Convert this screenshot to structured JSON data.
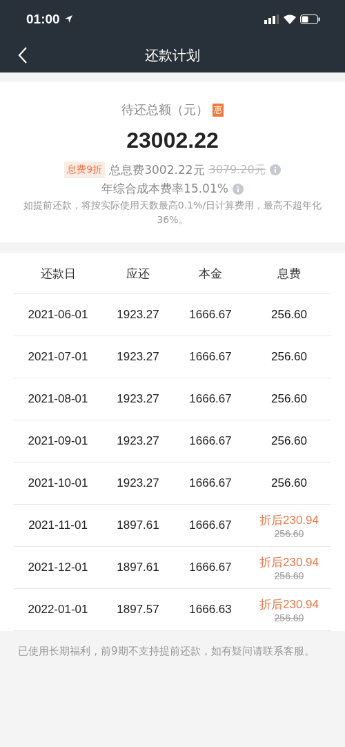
{
  "status_bar": {
    "time": "01:00"
  },
  "nav": {
    "title": "还款计划"
  },
  "summary": {
    "label": "待还总额（元）",
    "badge": "惠",
    "amount": "23002.22",
    "discount_tag": "息费9折",
    "total_fee": "总息费3002.22元",
    "original_fee": "3079.20元",
    "rate": "年综合成本费率15.01%",
    "note": "如提前还款，将按实际使用天数最高0.1%/日计算费用，最高不超年化36%。"
  },
  "table": {
    "columns": [
      "还款日",
      "应还",
      "本金",
      "息费"
    ],
    "rows": [
      {
        "kind": "plain",
        "date": "2021-06-01",
        "due": "1923.27",
        "principal": "1666.67",
        "fee": "256.60"
      },
      {
        "kind": "plain",
        "date": "2021-07-01",
        "due": "1923.27",
        "principal": "1666.67",
        "fee": "256.60"
      },
      {
        "kind": "plain",
        "date": "2021-08-01",
        "due": "1923.27",
        "principal": "1666.67",
        "fee": "256.60"
      },
      {
        "kind": "plain",
        "date": "2021-09-01",
        "due": "1923.27",
        "principal": "1666.67",
        "fee": "256.60"
      },
      {
        "kind": "plain",
        "date": "2021-10-01",
        "due": "1923.27",
        "principal": "1666.67",
        "fee": "256.60"
      },
      {
        "kind": "discounted",
        "date": "2021-11-01",
        "due": "1897.61",
        "principal": "1666.67",
        "fee": "折后230.94",
        "original_fee": "256.60"
      },
      {
        "kind": "discounted",
        "date": "2021-12-01",
        "due": "1897.61",
        "principal": "1666.67",
        "fee": "折后230.94",
        "original_fee": "256.60"
      },
      {
        "kind": "discounted",
        "date": "2022-01-01",
        "due": "1897.57",
        "principal": "1666.63",
        "fee": "折后230.94",
        "original_fee": "256.60"
      }
    ]
  },
  "footer_note": "已使用长期福利，前9期不支持提前还款，如有疑问请联系客服。"
}
